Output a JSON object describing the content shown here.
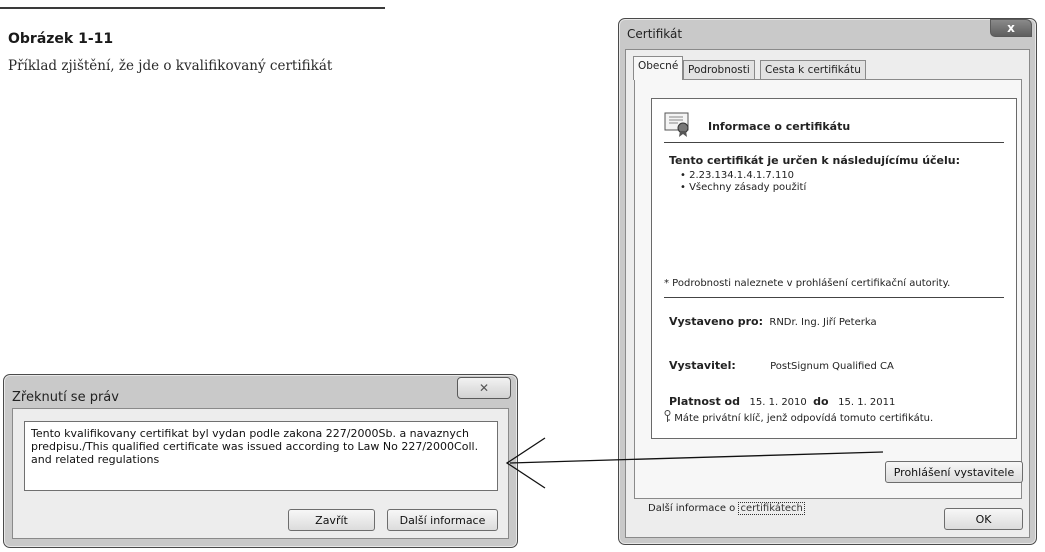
{
  "figure": {
    "title": "Obrázek 1-11",
    "caption": "Příklad zjištění, že jde o kvalifikovaný certifikát"
  },
  "certificate_window": {
    "title": "Certifikát",
    "close_glyph": "x",
    "tabs": [
      {
        "label": "Obecné",
        "active": true
      },
      {
        "label": "Podrobnosti",
        "active": false
      },
      {
        "label": "Cesta k certifikátu",
        "active": false
      }
    ],
    "header": "Informace o certifikátu",
    "purpose_title": "Tento certifikát je určen k následujícímu účelu:",
    "purposes": [
      "2.23.134.1.4.1.7.110",
      "Všechny zásady použití"
    ],
    "note": "* Podrobnosti naleznete v prohlášení certifikační autority.",
    "issued_to_label": "Vystaveno pro:",
    "issued_to_value": "RNDr. Ing. Jiří Peterka",
    "issuer_label": "Vystavitel:",
    "issuer_value": "PostSignum Qualified CA",
    "valid_from_label": "Platnost od",
    "valid_from_value": "15. 1. 2010",
    "valid_to_label": "do",
    "valid_to_value": "15. 1. 2011",
    "private_key_note": "Máte privátní klíč, jenž odpovídá tomuto certifikátu.",
    "issuer_statement_button": "Prohlášení vystavitele",
    "more_info_prefix": "Další informace o",
    "more_info_link": "certifikátech",
    "ok_button": "OK"
  },
  "disclaimer_window": {
    "title": "Zřeknutí se práv",
    "close_glyph": "✕",
    "text": "Tento kvalifikovany certifikat byl vydan podle zakona 227/2000Sb. a navaznych predpisu./This qualified certificate was issued according to Law No 227/2000Coll. and related regulations",
    "close_button": "Zavřít",
    "more_info_button": "Další informace"
  },
  "colors": {
    "window_frame": "#c9c9c9",
    "client_bg": "#ededed",
    "text": "#222222"
  }
}
